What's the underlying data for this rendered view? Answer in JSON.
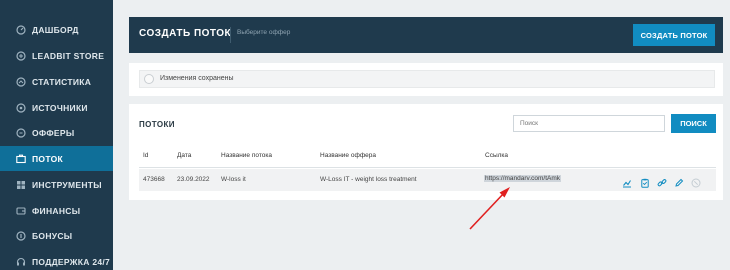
{
  "sidebar": {
    "items": [
      {
        "label": "ДАШБОРД",
        "icon": "gauge-icon"
      },
      {
        "label": "LEADBIT STORE",
        "icon": "store-icon"
      },
      {
        "label": "СТАТИСТИКА",
        "icon": "stats-icon"
      },
      {
        "label": "ИСТОЧНИКИ",
        "icon": "sources-icon"
      },
      {
        "label": "ОФФЕРЫ",
        "icon": "offers-icon"
      },
      {
        "label": "ПОТОК",
        "icon": "stream-icon",
        "active": true
      },
      {
        "label": "ИНСТРУМЕНТЫ",
        "icon": "tools-icon"
      },
      {
        "label": "ФИНАНСЫ",
        "icon": "finance-icon"
      },
      {
        "label": "БОНУСЫ",
        "icon": "bonus-icon"
      },
      {
        "label": "ПОДДЕРЖКА 24/7",
        "icon": "support-icon"
      }
    ]
  },
  "header": {
    "title": "СОЗДАТЬ ПОТОК",
    "offer_placeholder": "Выберите оффер",
    "create_button": "СОЗДАТЬ ПОТОК"
  },
  "notice": {
    "text": "Изменения сохранены"
  },
  "streams": {
    "title": "ПОТОКИ",
    "search_placeholder": "Поиск",
    "search_button": "ПОИСК",
    "columns": [
      "Id",
      "Дата",
      "Название потока",
      "Название оффера",
      "Ссылка"
    ],
    "rows": [
      {
        "id": "473668",
        "date": "23.09.2022",
        "stream_name": "W-loss it",
        "offer_name": "W-Loss IT - weight loss treatment",
        "link": "https://mandarv.com/tAmk"
      }
    ],
    "actions": [
      "stats-chart-icon",
      "clipboard-icon",
      "link-icon",
      "edit-pencil-icon",
      "delete-icon"
    ]
  },
  "colors": {
    "sidebar_bg": "#1f3a4d",
    "accent": "#118cc1",
    "active_item": "#0f6f99",
    "annotation_arrow": "#e02020"
  }
}
